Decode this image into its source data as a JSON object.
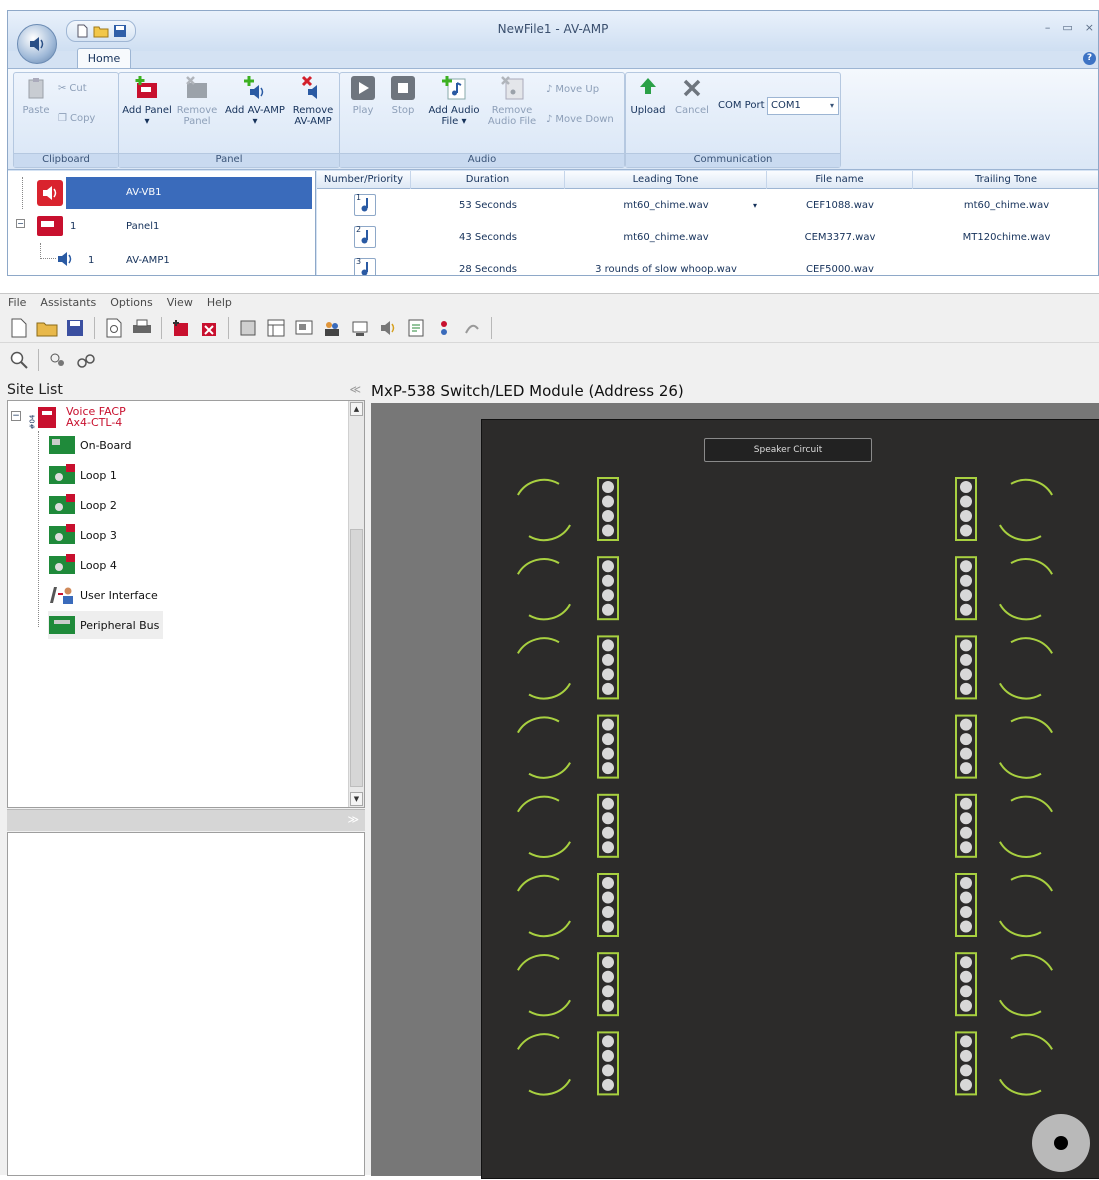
{
  "av_amp": {
    "title": "NewFile1 - AV-AMP",
    "tab": "Home",
    "groups": {
      "clipboard": {
        "label": "Clipboard",
        "paste": "Paste",
        "cut": "Cut",
        "copy": "Copy"
      },
      "panel": {
        "label": "Panel",
        "add_panel": "Add Panel",
        "remove_panel": "Remove Panel",
        "add_av_amp": "Add AV-AMP",
        "remove_av_amp": "Remove AV-AMP"
      },
      "audio": {
        "label": "Audio",
        "play": "Play",
        "stop": "Stop",
        "add_audio_file": "Add Audio File",
        "remove_audio_file": "Remove Audio File",
        "move_up": "Move Up",
        "move_down": "Move Down"
      },
      "communication": {
        "label": "Communication",
        "upload": "Upload",
        "cancel": "Cancel",
        "com_port_label": "COM Port",
        "com_port_value": "COM1"
      }
    },
    "tree": [
      {
        "num": "",
        "name": "AV-VB1",
        "icon": "speaker-red-icon",
        "selected": true
      },
      {
        "num": "1",
        "name": "Panel1",
        "icon": "panel-red-icon",
        "selected": false
      },
      {
        "num": "1",
        "name": "AV-AMP1",
        "icon": "speaker-blue-icon",
        "selected": false
      }
    ],
    "columns": [
      "Number/Priority",
      "Duration",
      "Leading Tone",
      "File name",
      "Trailing Tone"
    ],
    "rows": [
      {
        "num": "1",
        "duration": "53 Seconds",
        "leading": "mt60_chime.wav",
        "file": "CEF1088.wav",
        "trailing": "mt60_chime.wav"
      },
      {
        "num": "2",
        "duration": "43 Seconds",
        "leading": "mt60_chime.wav",
        "file": "CEM3377.wav",
        "trailing": "MT120chime.wav"
      },
      {
        "num": "3",
        "duration": "28 Seconds",
        "leading": "3 rounds of slow whoop.wav",
        "file": "CEF5000.wav",
        "trailing": ""
      }
    ]
  },
  "facp": {
    "menu": [
      "File",
      "Assistants",
      "Options",
      "View",
      "Help"
    ],
    "site_list_title": "Site List",
    "root": {
      "line1": "Voice FACP",
      "line2": "Ax4-CTL-4",
      "side": "#04"
    },
    "nodes": [
      "On-Board",
      "Loop 1",
      "Loop 2",
      "Loop 3",
      "Loop 4",
      "User Interface",
      "Peripheral Bus"
    ],
    "canvas_title": "MxP-538 Switch/LED Module (Address 26)",
    "module": {
      "speaker_label": "Speaker Circuit",
      "rows_per_side": 8,
      "led_color": "#a8d040"
    }
  }
}
